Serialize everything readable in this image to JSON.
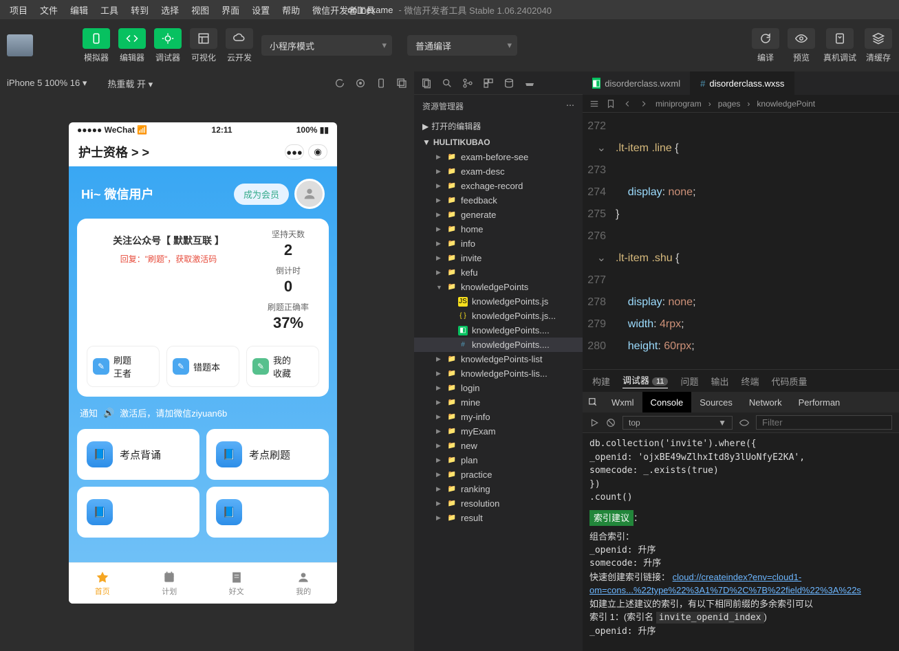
{
  "menu": [
    "项目",
    "文件",
    "编辑",
    "工具",
    "转到",
    "选择",
    "视图",
    "界面",
    "设置",
    "帮助",
    "微信开发者工具"
  ],
  "title": {
    "project": "onlinexame",
    "suffix": "微信开发者工具 Stable 1.06.2402040"
  },
  "toolbar": {
    "simulator": "模拟器",
    "editor": "编辑器",
    "debugger": "调试器",
    "visual": "可视化",
    "cloud": "云开发",
    "mode": "小程序模式",
    "compile_mode": "普通编译",
    "compile": "编译",
    "preview": "预览",
    "remote": "真机调试",
    "clear": "清缓存"
  },
  "simbar": {
    "device": "iPhone 5 100% 16",
    "hot": "热重载 开"
  },
  "phone": {
    "wechat": "WeChat",
    "time": "12:11",
    "battery": "100%",
    "title": "护士资格 > >",
    "greeting": "Hi~ 微信用户",
    "member": "成为会员",
    "gzh": "关注公众号【 默默互联 】",
    "gzh_sub": "回复：\"刷题\"，获取激活码",
    "stats": {
      "daysLabel": "坚持天数",
      "days": "2",
      "countdownLabel": "倒计时",
      "countdown": "0",
      "accuracyLabel": "刷题正确率",
      "accuracy": "37%"
    },
    "three": [
      {
        "l1": "刷题",
        "l2": "王者",
        "c": "#4aa7f0"
      },
      {
        "l1": "错题本",
        "l2": "",
        "c": "#4aa7f0"
      },
      {
        "l1": "我的",
        "l2": "收藏",
        "c": "#56c08d"
      }
    ],
    "noticeLabel": "通知",
    "noticeText": "激活后，请加微信ziyuan6b",
    "grid": [
      "考点背诵",
      "考点刷题",
      "",
      ""
    ],
    "tabs": [
      "首页",
      "计划",
      "好文",
      "我的"
    ]
  },
  "explorer": {
    "title": "资源管理器",
    "open": "打开的编辑器",
    "root": "HULITIKUBAO",
    "items": [
      {
        "n": "exam-before-see",
        "t": "folder"
      },
      {
        "n": "exam-desc",
        "t": "folder"
      },
      {
        "n": "exchage-record",
        "t": "folder"
      },
      {
        "n": "feedback",
        "t": "folder"
      },
      {
        "n": "generate",
        "t": "folder"
      },
      {
        "n": "home",
        "t": "folder"
      },
      {
        "n": "info",
        "t": "folder"
      },
      {
        "n": "invite",
        "t": "folder"
      },
      {
        "n": "kefu",
        "t": "folder"
      },
      {
        "n": "knowledgePoints",
        "t": "folder",
        "open": true,
        "children": [
          {
            "n": "knowledgePoints.js",
            "t": "js"
          },
          {
            "n": "knowledgePoints.js...",
            "t": "json"
          },
          {
            "n": "knowledgePoints....",
            "t": "wxml"
          },
          {
            "n": "knowledgePoints....",
            "t": "wxss",
            "sel": true
          }
        ]
      },
      {
        "n": "knowledgePoints-list",
        "t": "folder"
      },
      {
        "n": "knowledgePoints-lis...",
        "t": "folder"
      },
      {
        "n": "login",
        "t": "folder"
      },
      {
        "n": "mine",
        "t": "folder"
      },
      {
        "n": "my-info",
        "t": "folder"
      },
      {
        "n": "myExam",
        "t": "folder"
      },
      {
        "n": "new",
        "t": "folder"
      },
      {
        "n": "plan",
        "t": "folder"
      },
      {
        "n": "practice",
        "t": "folder"
      },
      {
        "n": "ranking",
        "t": "folder"
      },
      {
        "n": "resolution",
        "t": "folder"
      },
      {
        "n": "result",
        "t": "folder"
      }
    ]
  },
  "tabs": [
    {
      "name": "disorderclass.wxml",
      "icon": "wxml"
    },
    {
      "name": "disorderclass.wxss",
      "icon": "wxss",
      "active": true
    }
  ],
  "breadcrumb": [
    "miniprogram",
    "pages",
    "knowledgePoint"
  ],
  "code": [
    {
      "n": 272,
      "t": ""
    },
    {
      "n": 273,
      "t": "",
      "sel": ".lt-item .line ",
      "b": "{",
      "fold": true
    },
    {
      "n": 274,
      "t": "    ",
      "p": "display",
      "v": "none",
      "e": ";"
    },
    {
      "n": 275,
      "t": "",
      "b": "}"
    },
    {
      "n": 276,
      "t": ""
    },
    {
      "n": 277,
      "t": "",
      "sel": ".lt-item .shu ",
      "b": "{",
      "fold": true
    },
    {
      "n": 278,
      "t": "    ",
      "p": "display",
      "v": "none",
      "e": ";"
    },
    {
      "n": 279,
      "t": "    ",
      "p": "width",
      "v": "4rpx",
      "e": ";"
    },
    {
      "n": 280,
      "t": "    ",
      "p": "height",
      "v": "60rpx",
      "e": ";"
    }
  ],
  "panel": {
    "tabs": [
      "构建",
      "调试器",
      "问题",
      "输出",
      "终端",
      "代码质量"
    ],
    "active": 1,
    "badge": "11",
    "devtabs": [
      "Wxml",
      "Console",
      "Sources",
      "Network",
      "Performan"
    ],
    "devactive": 1,
    "context": "top",
    "filter": "Filter",
    "lines": [
      "db.collection('invite').where({",
      "  _openid: 'ojxBE49wZlhxItd8y3lUoNfyE2KA',",
      "  somecode: _.exists(true)",
      "})",
      ".count()"
    ],
    "suggest": "索引建议",
    "suggestColon": "：",
    "combo": "组合索引：",
    "l1": "  _openid: 升序",
    "l2": "  somecode: 升序",
    "quick": "快速创建索引链接：",
    "link": "cloud://createindex?env=cloud1-",
    "link2": "om=cons...%22type%22%3A1%7D%2C%7B%22field%22%3A%22s",
    "warn": "如建立上述建议的索引，有以下相同前缀的多余索引可以",
    "idx": "索引 1：(索引名 ",
    "idxname": "invite_openid_index",
    "idxend": ")",
    "l3": "  _openid: 升序"
  }
}
